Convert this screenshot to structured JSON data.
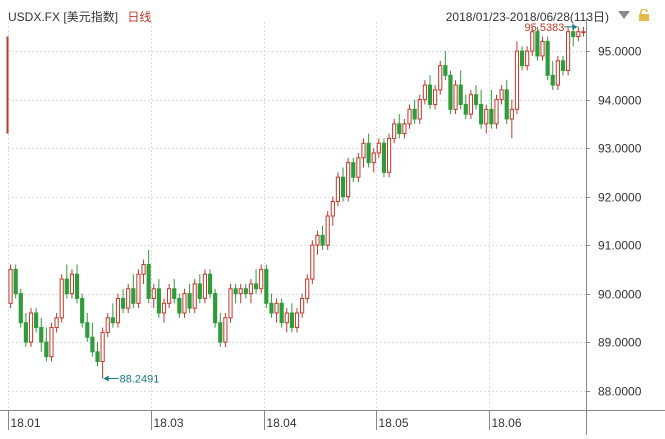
{
  "header": {
    "symbol": "USDX.FX",
    "name": "[美元指数]",
    "period": "日线",
    "range": "2018/01/23-2018/06/28(113日)"
  },
  "colors": {
    "up": "#c0392b",
    "down": "#2e9c3a",
    "grid": "#dddddd",
    "axis": "#888888",
    "annotation": "#1a7a8a"
  },
  "icons": {
    "dropdown": "triangle-down-icon",
    "lock": "lock-icon"
  },
  "chart_data": {
    "type": "candlestick",
    "ylim": [
      87.6,
      95.6
    ],
    "ytick_labels": [
      "88.0000",
      "89.0000",
      "90.0000",
      "91.0000",
      "92.0000",
      "93.0000",
      "94.0000",
      "95.0000"
    ],
    "yticks": [
      88,
      89,
      90,
      91,
      92,
      93,
      94,
      95
    ],
    "xtick_labels": [
      "18.01",
      "18.03",
      "18.04",
      "18.05",
      "18.06"
    ],
    "xtick_index": [
      0,
      28,
      50,
      72,
      94
    ],
    "annotations": {
      "low": "88.2491",
      "high": "95.5383",
      "low_index": 18,
      "high_index": 111
    },
    "ohlc": [
      [
        89.8,
        90.6,
        89.7,
        90.5
      ],
      [
        90.5,
        90.6,
        89.9,
        90.0
      ],
      [
        90.0,
        90.1,
        89.3,
        89.4
      ],
      [
        89.4,
        89.6,
        88.9,
        89.0
      ],
      [
        89.0,
        89.7,
        88.9,
        89.6
      ],
      [
        89.6,
        89.7,
        89.2,
        89.3
      ],
      [
        89.3,
        89.5,
        88.8,
        89.0
      ],
      [
        89.0,
        89.3,
        88.6,
        88.7
      ],
      [
        88.7,
        89.4,
        88.6,
        89.3
      ],
      [
        89.3,
        89.6,
        89.2,
        89.5
      ],
      [
        89.5,
        90.4,
        89.4,
        90.3
      ],
      [
        90.3,
        90.6,
        89.9,
        90.0
      ],
      [
        90.0,
        90.5,
        89.9,
        90.4
      ],
      [
        90.4,
        90.6,
        89.8,
        89.9
      ],
      [
        89.9,
        90.0,
        89.3,
        89.4
      ],
      [
        89.4,
        89.6,
        89.0,
        89.1
      ],
      [
        89.1,
        89.4,
        88.7,
        88.8
      ],
      [
        88.8,
        89.0,
        88.5,
        88.6
      ],
      [
        88.6,
        89.3,
        88.25,
        89.2
      ],
      [
        89.2,
        89.6,
        89.1,
        89.5
      ],
      [
        89.5,
        89.8,
        89.3,
        89.4
      ],
      [
        89.4,
        90.0,
        89.3,
        89.9
      ],
      [
        89.9,
        90.1,
        89.6,
        89.7
      ],
      [
        89.7,
        90.2,
        89.6,
        90.1
      ],
      [
        90.1,
        90.4,
        89.7,
        89.8
      ],
      [
        89.8,
        90.5,
        89.7,
        90.4
      ],
      [
        90.4,
        90.7,
        90.2,
        90.6
      ],
      [
        90.6,
        90.9,
        89.8,
        89.9
      ],
      [
        89.9,
        90.2,
        89.7,
        90.1
      ],
      [
        90.1,
        90.3,
        89.5,
        89.6
      ],
      [
        89.6,
        89.9,
        89.4,
        89.8
      ],
      [
        89.8,
        90.2,
        89.7,
        90.1
      ],
      [
        90.1,
        90.3,
        89.8,
        89.9
      ],
      [
        89.9,
        90.0,
        89.5,
        89.6
      ],
      [
        89.6,
        90.1,
        89.5,
        90.0
      ],
      [
        90.0,
        90.2,
        89.6,
        89.7
      ],
      [
        89.7,
        90.3,
        89.6,
        90.2
      ],
      [
        90.2,
        90.4,
        89.8,
        89.9
      ],
      [
        89.9,
        90.5,
        89.8,
        90.4
      ],
      [
        90.4,
        90.5,
        89.9,
        90.0
      ],
      [
        90.0,
        90.1,
        89.3,
        89.4
      ],
      [
        89.4,
        89.6,
        88.9,
        89.0
      ],
      [
        89.0,
        89.6,
        88.9,
        89.5
      ],
      [
        89.5,
        90.2,
        89.4,
        90.1
      ],
      [
        90.1,
        90.2,
        89.8,
        90.0
      ],
      [
        90.0,
        90.2,
        89.8,
        90.1
      ],
      [
        90.1,
        90.2,
        89.9,
        90.0
      ],
      [
        90.0,
        90.3,
        89.8,
        90.2
      ],
      [
        90.2,
        90.5,
        90.0,
        90.1
      ],
      [
        90.1,
        90.6,
        90.0,
        90.5
      ],
      [
        90.5,
        90.6,
        89.7,
        89.8
      ],
      [
        89.8,
        90.0,
        89.5,
        89.6
      ],
      [
        89.6,
        89.9,
        89.4,
        89.8
      ],
      [
        89.8,
        89.9,
        89.3,
        89.4
      ],
      [
        89.4,
        89.7,
        89.2,
        89.6
      ],
      [
        89.6,
        89.8,
        89.2,
        89.3
      ],
      [
        89.3,
        89.7,
        89.2,
        89.6
      ],
      [
        89.6,
        90.0,
        89.5,
        89.9
      ],
      [
        89.9,
        90.4,
        89.8,
        90.3
      ],
      [
        90.3,
        91.1,
        90.2,
        91.0
      ],
      [
        91.0,
        91.3,
        90.8,
        91.2
      ],
      [
        91.2,
        91.4,
        90.9,
        91.0
      ],
      [
        91.0,
        91.7,
        90.9,
        91.6
      ],
      [
        91.6,
        92.0,
        91.4,
        91.9
      ],
      [
        91.9,
        92.5,
        91.8,
        92.4
      ],
      [
        92.4,
        92.6,
        91.9,
        92.0
      ],
      [
        92.0,
        92.8,
        91.9,
        92.7
      ],
      [
        92.7,
        92.8,
        92.3,
        92.4
      ],
      [
        92.4,
        92.9,
        92.3,
        92.8
      ],
      [
        92.8,
        93.2,
        92.6,
        93.1
      ],
      [
        93.1,
        93.3,
        92.6,
        92.7
      ],
      [
        92.7,
        93.0,
        92.5,
        92.9
      ],
      [
        92.9,
        93.2,
        92.8,
        93.1
      ],
      [
        93.1,
        93.2,
        92.4,
        92.5
      ],
      [
        92.5,
        93.3,
        92.4,
        93.2
      ],
      [
        93.2,
        93.6,
        93.1,
        93.5
      ],
      [
        93.5,
        93.7,
        93.2,
        93.3
      ],
      [
        93.3,
        93.6,
        93.2,
        93.5
      ],
      [
        93.5,
        93.9,
        93.4,
        93.8
      ],
      [
        93.8,
        94.0,
        93.5,
        93.6
      ],
      [
        93.6,
        94.1,
        93.5,
        94.0
      ],
      [
        94.0,
        94.4,
        93.9,
        94.3
      ],
      [
        94.3,
        94.5,
        93.8,
        93.9
      ],
      [
        93.9,
        94.3,
        93.8,
        94.2
      ],
      [
        94.2,
        94.8,
        94.1,
        94.7
      ],
      [
        94.7,
        95.0,
        94.4,
        94.5
      ],
      [
        94.5,
        94.6,
        93.7,
        93.8
      ],
      [
        93.8,
        94.4,
        93.7,
        94.3
      ],
      [
        94.3,
        94.6,
        93.8,
        93.9
      ],
      [
        93.9,
        94.1,
        93.6,
        93.7
      ],
      [
        93.7,
        94.2,
        93.6,
        94.1
      ],
      [
        94.1,
        94.3,
        93.8,
        93.9
      ],
      [
        93.9,
        94.2,
        93.4,
        93.5
      ],
      [
        93.5,
        93.9,
        93.3,
        93.8
      ],
      [
        93.8,
        94.2,
        93.4,
        93.5
      ],
      [
        93.5,
        94.1,
        93.4,
        94.0
      ],
      [
        94.0,
        94.3,
        93.9,
        94.2
      ],
      [
        94.2,
        94.4,
        93.5,
        93.6
      ],
      [
        93.6,
        94.0,
        93.2,
        93.8
      ],
      [
        93.8,
        95.2,
        93.7,
        95.0
      ],
      [
        95.0,
        95.1,
        94.6,
        94.7
      ],
      [
        94.7,
        95.1,
        94.6,
        95.0
      ],
      [
        95.0,
        95.5,
        94.9,
        95.4
      ],
      [
        95.4,
        95.5,
        94.8,
        94.9
      ],
      [
        94.9,
        95.3,
        94.8,
        95.2
      ],
      [
        95.2,
        95.3,
        94.4,
        94.5
      ],
      [
        94.5,
        94.8,
        94.2,
        94.3
      ],
      [
        94.3,
        94.9,
        94.2,
        94.8
      ],
      [
        94.8,
        94.9,
        94.5,
        94.6
      ],
      [
        94.6,
        95.5,
        94.5,
        95.4
      ],
      [
        95.4,
        95.54,
        95.1,
        95.3
      ],
      [
        95.3,
        95.5,
        95.2,
        95.4
      ],
      [
        95.4,
        95.5,
        95.3,
        95.4
      ]
    ]
  }
}
